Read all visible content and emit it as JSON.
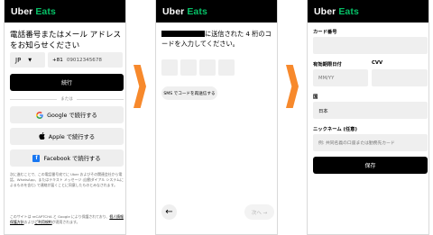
{
  "brand": {
    "uber": "Uber",
    "eats": "Eats"
  },
  "screen1": {
    "heading": "電話番号またはメール アドレスをお知らせください",
    "country_code": "JP",
    "phone_prefix": "+81",
    "phone_placeholder": "09012345678",
    "continue_label": "続行",
    "or_label": "または",
    "google_label": "Google で続行する",
    "apple_label": "Apple で続行する",
    "facebook_label": "Facebook で続行する",
    "consent_text": "次に進むことで、この電話番号宛てに Uber およびその関連会社から電話、WhatsApp、またはテキスト メッセージ (自動ダイアル システムによるものを含む) で連絡が届くことに同意したものとみなされます。",
    "recaptcha_text_1": "このサイトは reCAPTCHA と Google により保護されており、",
    "privacy_link": "個人情報保護方針",
    "recaptcha_text_2": "および",
    "terms_link": "ご利用規約",
    "recaptcha_text_3": "が適用されます。"
  },
  "screen2": {
    "prompt": "に送信された 4 桁のコードを入力してください。",
    "resend_label": "SMS でコードを再送信する",
    "back_icon": "←",
    "next_label": "次へ →"
  },
  "screen3": {
    "card_number_label": "カード番号",
    "expiry_label": "有効期限日付",
    "expiry_placeholder": "MM/YY",
    "cvv_label": "CVV",
    "country_label": "国",
    "country_value": "日本",
    "nickname_label": "ニックネーム (任意)",
    "nickname_placeholder": "例: 共同名義の口座または勤務先カード",
    "save_label": "保存"
  },
  "colors": {
    "brand_green": "#06c167",
    "arrow_orange": "#f7892c",
    "facebook_blue": "#1877f2"
  },
  "icons": [
    "google-icon",
    "apple-icon",
    "facebook-icon",
    "chevron-down-icon",
    "back-arrow-icon",
    "next-arrow-icon"
  ]
}
